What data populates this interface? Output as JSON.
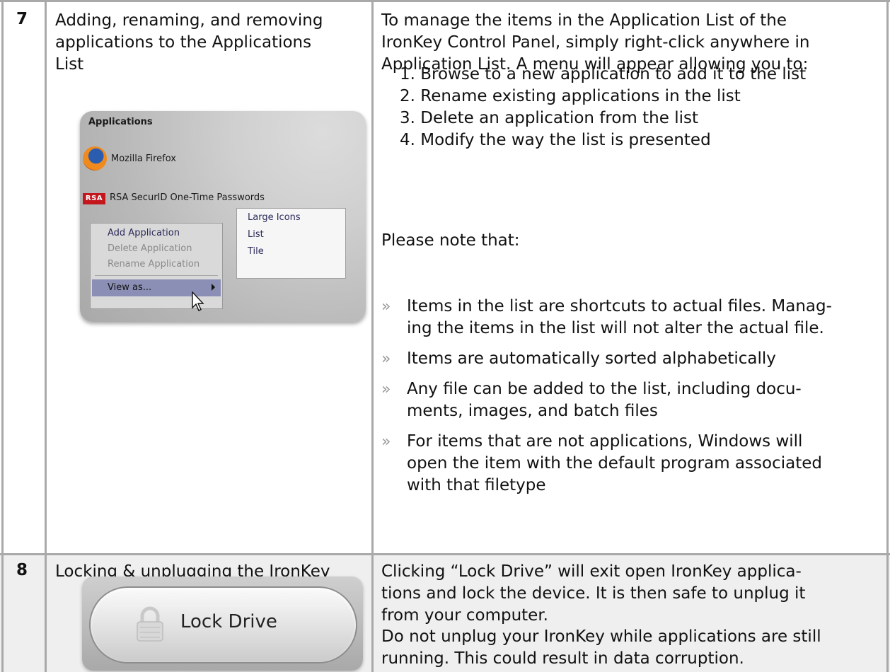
{
  "row7": {
    "number": "7",
    "title_lines": [
      "Adding, renaming, and removing",
      "applications to the Applications",
      "List"
    ],
    "desc_lines": [
      "To manage the items in the Application List of the",
      "IronKey Control Panel, simply right-click anywhere in",
      "Application List.  A menu will appear allowing you to:"
    ],
    "steps": [
      "1. Browse to a new application to add it to the list",
      "2. Rename existing applications in the list",
      "3. Delete an application from the list",
      "4. Modify the way the list is presented"
    ],
    "note_heading": "Please note that:",
    "bullet_marker": "»",
    "bullets": [
      [
        "Items in the list are shortcuts to actual files.  Manag-",
        "ing the items in the list will not alter the actual file."
      ],
      [
        "Items are automatically sorted alphabetically"
      ],
      [
        "Any file can be added to the list, including docu-",
        "ments, images, and batch files"
      ],
      [
        "For items that are not applications, Windows will",
        "open the item with the default program associated",
        "with that filetype"
      ]
    ],
    "panel": {
      "title": "Applications",
      "apps": [
        "Mozilla Firefox",
        "RSA SecurID One-Time Passwords"
      ],
      "rsa_logo_text": "RSA",
      "menu": [
        "Add Application",
        "Delete Application",
        "Rename Application",
        "View as..."
      ],
      "submenu": [
        "Large Icons",
        "List",
        "Tile"
      ]
    }
  },
  "row8": {
    "number": "8",
    "title": "Locking & unplugging the IronKey",
    "desc_lines": [
      "Clicking “Lock Drive” will exit open IronKey applica-",
      "tions and lock the device.  It is then safe to unplug it",
      "from your computer."
    ],
    "warning_lines": [
      "Do not unplug your IronKey while applications are still",
      "running.  This could result in data corruption."
    ],
    "button_label": "Lock Drive"
  },
  "colors": {
    "grid": "#a9a9a9",
    "row8_bg": "#efefef",
    "bullet": "#9a9a9a"
  }
}
